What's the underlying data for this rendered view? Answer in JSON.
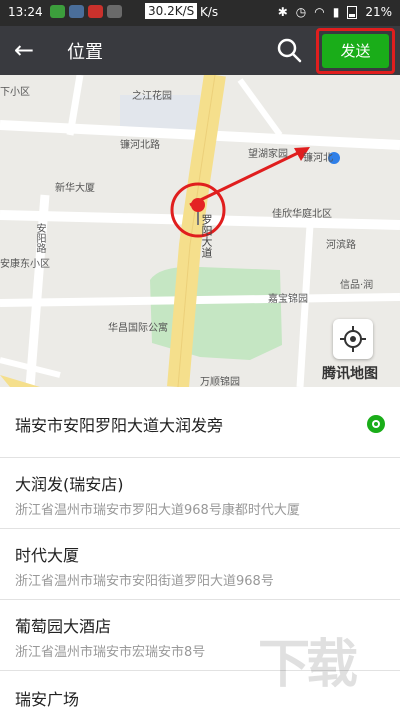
{
  "status_bar": {
    "time": "13:24",
    "net_speed": "30.2K/S",
    "net_unit": "K/s",
    "battery": "21%"
  },
  "header": {
    "title": "位置",
    "send_label": "发送"
  },
  "map": {
    "labels": {
      "xiaoqu": "下小区",
      "zhijiang": "之江花园",
      "lianhebeilu": "镰河北路",
      "wangyujia": "望湖家园",
      "lianhe_east": "镰河北",
      "xinhua": "新华大厦",
      "jiaxin": "佳欣华庭北区",
      "hebin": "河滨路",
      "anyang": "安阳路",
      "anke": "安康东小区",
      "jiabao": "嘉宝锦园",
      "xinpin": "信品·润",
      "huachang": "华昌国际公寓",
      "wanshun": "万顺锦园",
      "luoyang_road": "罗阳大道"
    },
    "brand": "腾讯地图"
  },
  "places": [
    {
      "name": "瑞安市安阳罗阳大道大润发旁",
      "address": "",
      "selected": true
    },
    {
      "name": "大润发(瑞安店)",
      "address": "浙江省温州市瑞安市罗阳大道968号康都时代大厦"
    },
    {
      "name": "时代大厦",
      "address": "浙江省温州市瑞安市安阳街道罗阳大道968号"
    },
    {
      "name": "葡萄园大酒店",
      "address": "浙江省温州市瑞安市宏瑞安市8号"
    },
    {
      "name": "瑞安广场",
      "address": ""
    }
  ],
  "watermark": "下载吧",
  "colors": {
    "accent": "#1aad19",
    "header_bg": "#393a3f",
    "highlight": "#e01e1e"
  }
}
